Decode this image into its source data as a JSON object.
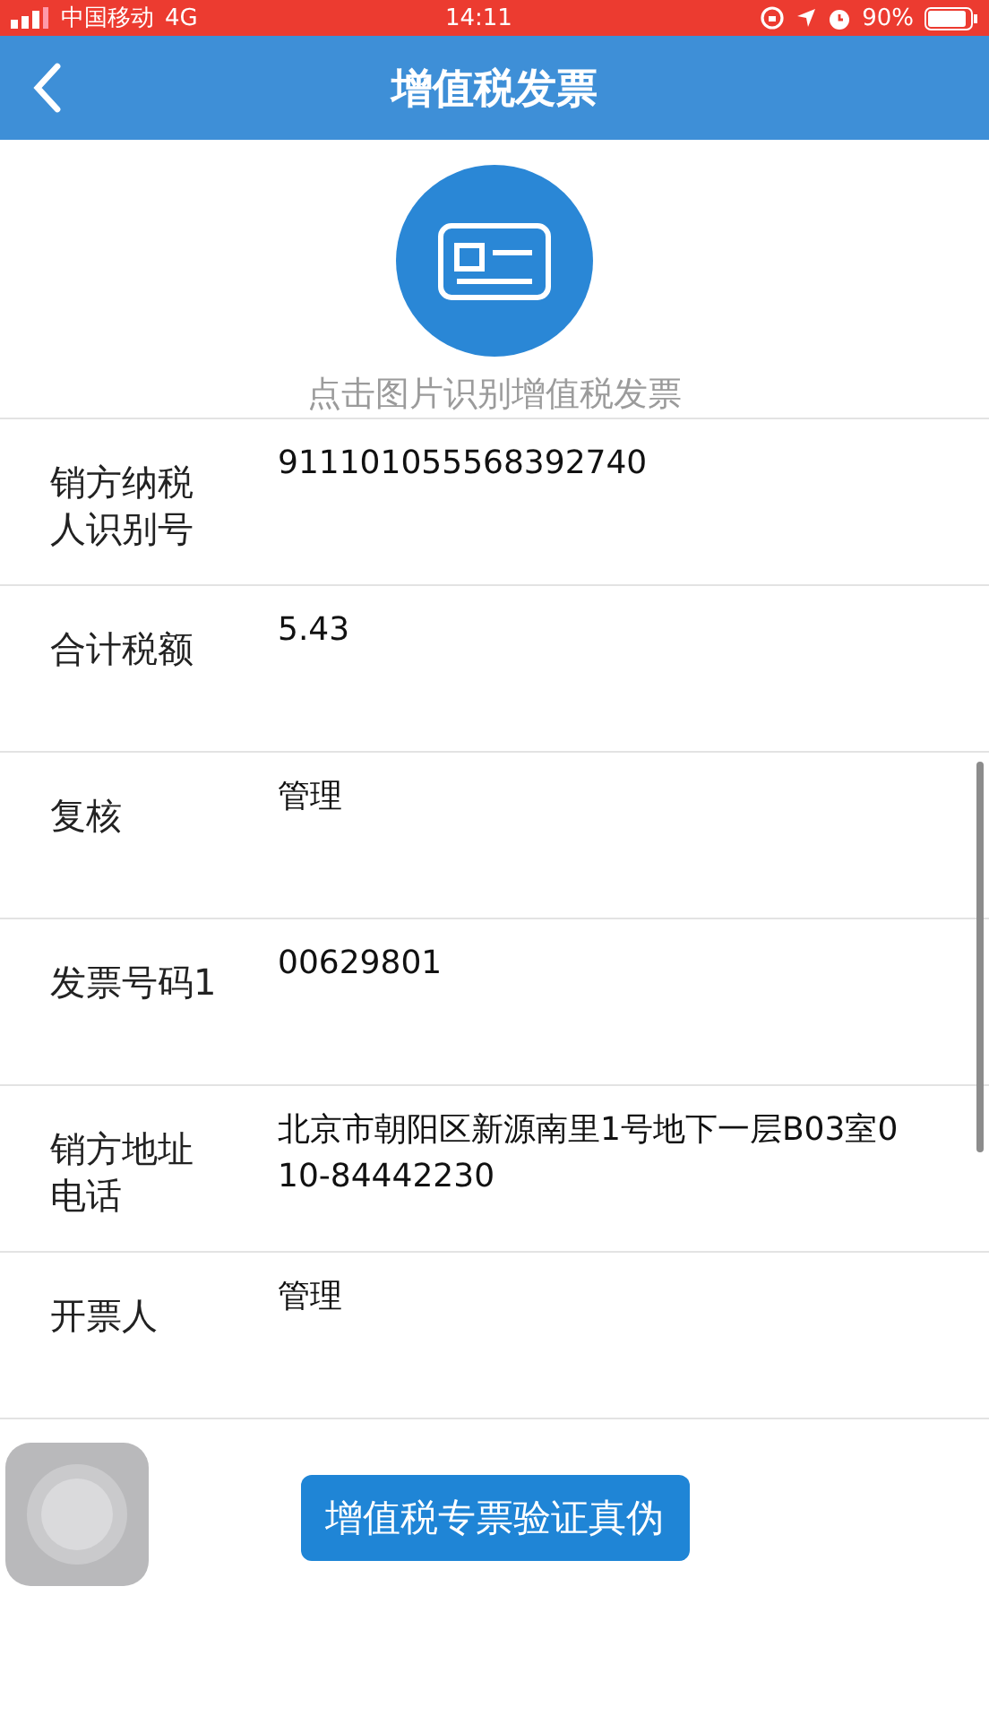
{
  "status_bar": {
    "carrier": "中国移动",
    "network": "4G",
    "time": "14:11",
    "battery": "90%"
  },
  "nav": {
    "title": "增值税发票"
  },
  "scan": {
    "caption": "点击图片识别增值税发票"
  },
  "fields": [
    {
      "label": "销方纳税人识别号",
      "value": "911101055568392740"
    },
    {
      "label": "合计税额",
      "value": "5.43"
    },
    {
      "label": "复核",
      "value": "管理"
    },
    {
      "label": "发票号码1",
      "value": "00629801"
    },
    {
      "label": "销方地址电话",
      "value": "北京市朝阳区新源南里1号地下一层B03室010-84442230"
    },
    {
      "label": "开票人",
      "value": "管理"
    }
  ],
  "verify_button": "增值税专票验证真伪"
}
